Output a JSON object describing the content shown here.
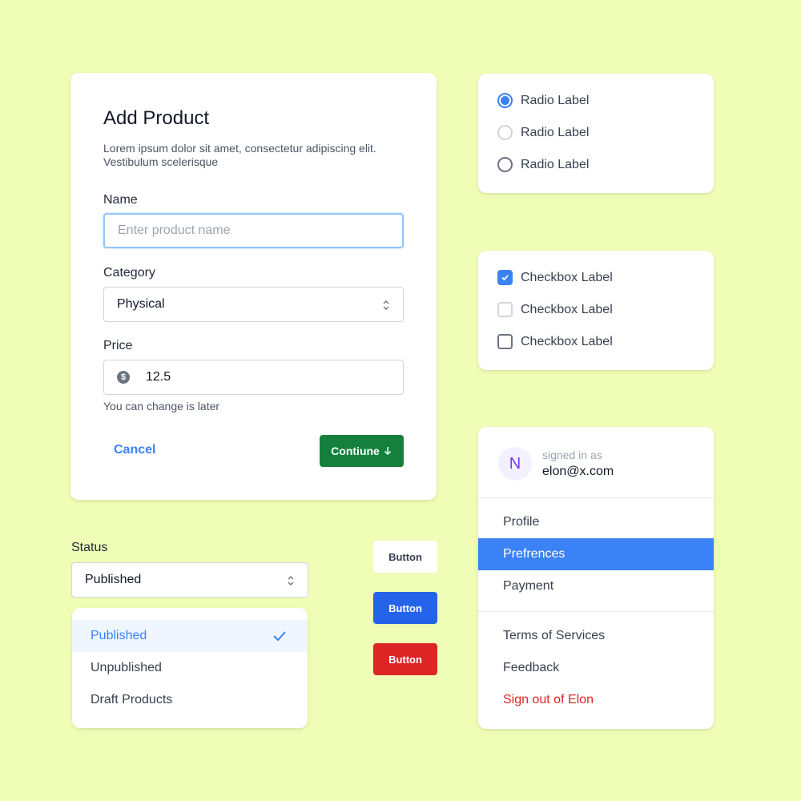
{
  "colors": {
    "background": "#f0fdb6",
    "accent": "#3b82f6",
    "primary_button": "#2563eb",
    "continue_button": "#15803d",
    "danger": "#dc2626"
  },
  "product_form": {
    "title": "Add Product",
    "description": "Lorem ipsum dolor sit amet, consectetur adipiscing elit. Vestibulum scelerisque",
    "name_label": "Name",
    "name_placeholder": "Enter product name",
    "name_value": "",
    "category_label": "Category",
    "category_value": "Physical",
    "price_label": "Price",
    "price_icon": "dollar-icon",
    "price_value": "12.5",
    "price_hint": "You can change is later",
    "cancel_label": "Cancel",
    "continue_label": "Contiune",
    "continue_icon": "arrow-down-icon"
  },
  "radios": [
    {
      "label": "Radio Label",
      "state": "checked"
    },
    {
      "label": "Radio Label",
      "state": "disabled"
    },
    {
      "label": "Radio Label",
      "state": "unchecked"
    }
  ],
  "checkboxes": [
    {
      "label": "Checkbox Label",
      "state": "checked"
    },
    {
      "label": "Checkbox Label",
      "state": "disabled"
    },
    {
      "label": "Checkbox Label",
      "state": "unchecked"
    }
  ],
  "account_menu": {
    "avatar_initial": "N",
    "signed_in_text": "signed in as",
    "email": "elon@x.com",
    "items": [
      {
        "label": "Profile"
      },
      {
        "label": "Prefrences",
        "active": true
      },
      {
        "label": "Payment"
      }
    ],
    "footer_items": [
      {
        "label": "Terms of Services"
      },
      {
        "label": "Feedback"
      },
      {
        "label": "Sign out of Elon",
        "danger": true
      }
    ]
  },
  "status": {
    "label": "Status",
    "value": "Published",
    "options": [
      "Published",
      "Unpublished",
      "Draft Products"
    ],
    "selected_index": 0
  },
  "buttons": {
    "white": "Button",
    "blue": "Button",
    "red": "Button"
  }
}
